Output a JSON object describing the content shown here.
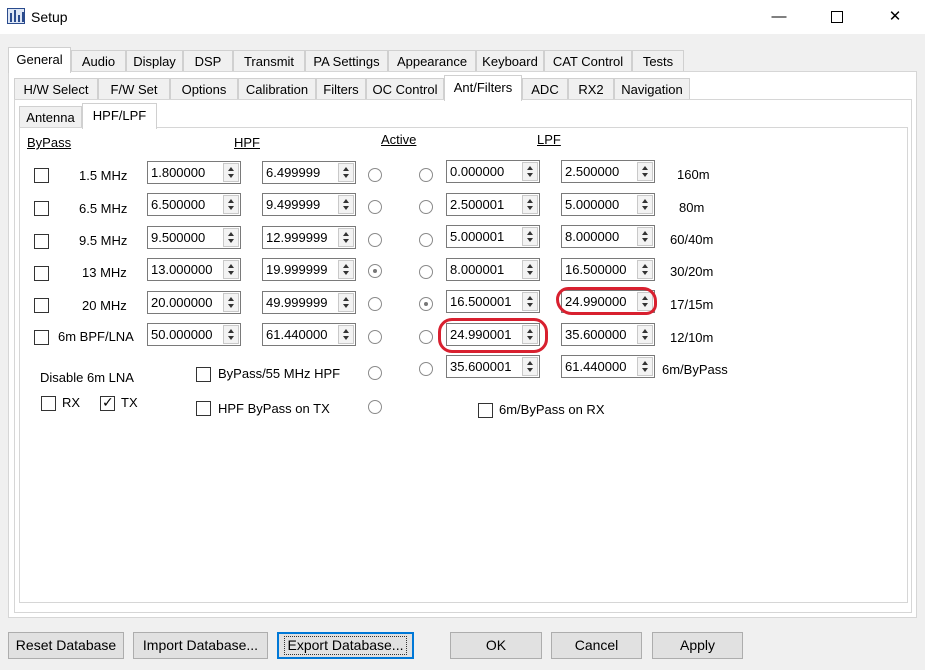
{
  "window": {
    "title": "Setup",
    "minimize_glyph": "—",
    "close_glyph": "✕"
  },
  "main_tabs": [
    "General",
    "Audio",
    "Display",
    "DSP",
    "Transmit",
    "PA Settings",
    "Appearance",
    "Keyboard",
    "CAT Control",
    "Tests"
  ],
  "sub_tabs": [
    "H/W Select",
    "F/W Set",
    "Options",
    "Calibration",
    "Filters",
    "OC Control",
    "Ant/Filters",
    "ADC",
    "RX2",
    "Navigation"
  ],
  "inner_tabs": [
    "Antenna",
    "HPF/LPF"
  ],
  "headers": {
    "bypass": "ByPass",
    "hpf": "HPF",
    "active": "Active",
    "lpf": "LPF"
  },
  "rows": [
    {
      "band": "1.5 MHz",
      "hpf_low": "1.800000",
      "hpf_high": "6.499999",
      "lpf_low": "0.000000",
      "lpf_high": "2.500000",
      "lpf_band": "160m"
    },
    {
      "band": "6.5 MHz",
      "hpf_low": "6.500000",
      "hpf_high": "9.499999",
      "lpf_low": "2.500001",
      "lpf_high": "5.000000",
      "lpf_band": "80m"
    },
    {
      "band": "9.5 MHz",
      "hpf_low": "9.500000",
      "hpf_high": "12.999999",
      "lpf_low": "5.000001",
      "lpf_high": "8.000000",
      "lpf_band": "60/40m"
    },
    {
      "band": "13 MHz",
      "hpf_low": "13.000000",
      "hpf_high": "19.999999",
      "lpf_low": "8.000001",
      "lpf_high": "16.500000",
      "lpf_band": "30/20m"
    },
    {
      "band": "20 MHz",
      "hpf_low": "20.000000",
      "hpf_high": "49.999999",
      "lpf_low": "16.500001",
      "lpf_high": "24.990000",
      "lpf_band": "17/15m"
    },
    {
      "band": "6m BPF/LNA",
      "hpf_low": "50.000000",
      "hpf_high": "61.440000",
      "lpf_low": "24.990001",
      "lpf_high": "35.600000",
      "lpf_band": "12/10m"
    },
    {
      "band": "",
      "hpf_low": "",
      "hpf_high": "",
      "lpf_low": "35.600001",
      "lpf_high": "61.440000",
      "lpf_band": "6m/ByPass"
    }
  ],
  "hpf_active_row": 3,
  "lpf_active_row": 4,
  "options": {
    "disable_6m_lna": "Disable 6m LNA",
    "rx": "RX",
    "tx": "TX",
    "tx_checked": true,
    "bypass_55": "ByPass/55 MHz HPF",
    "hpf_bypass_tx": "HPF ByPass on TX",
    "bypass_6m_rx": "6m/ByPass on RX"
  },
  "buttons": {
    "reset": "Reset Database",
    "import": "Import Database...",
    "export": "Export Database...",
    "ok": "OK",
    "cancel": "Cancel",
    "apply": "Apply"
  },
  "colors": {
    "annotation": "#d8202f",
    "focus": "#0078d7"
  }
}
